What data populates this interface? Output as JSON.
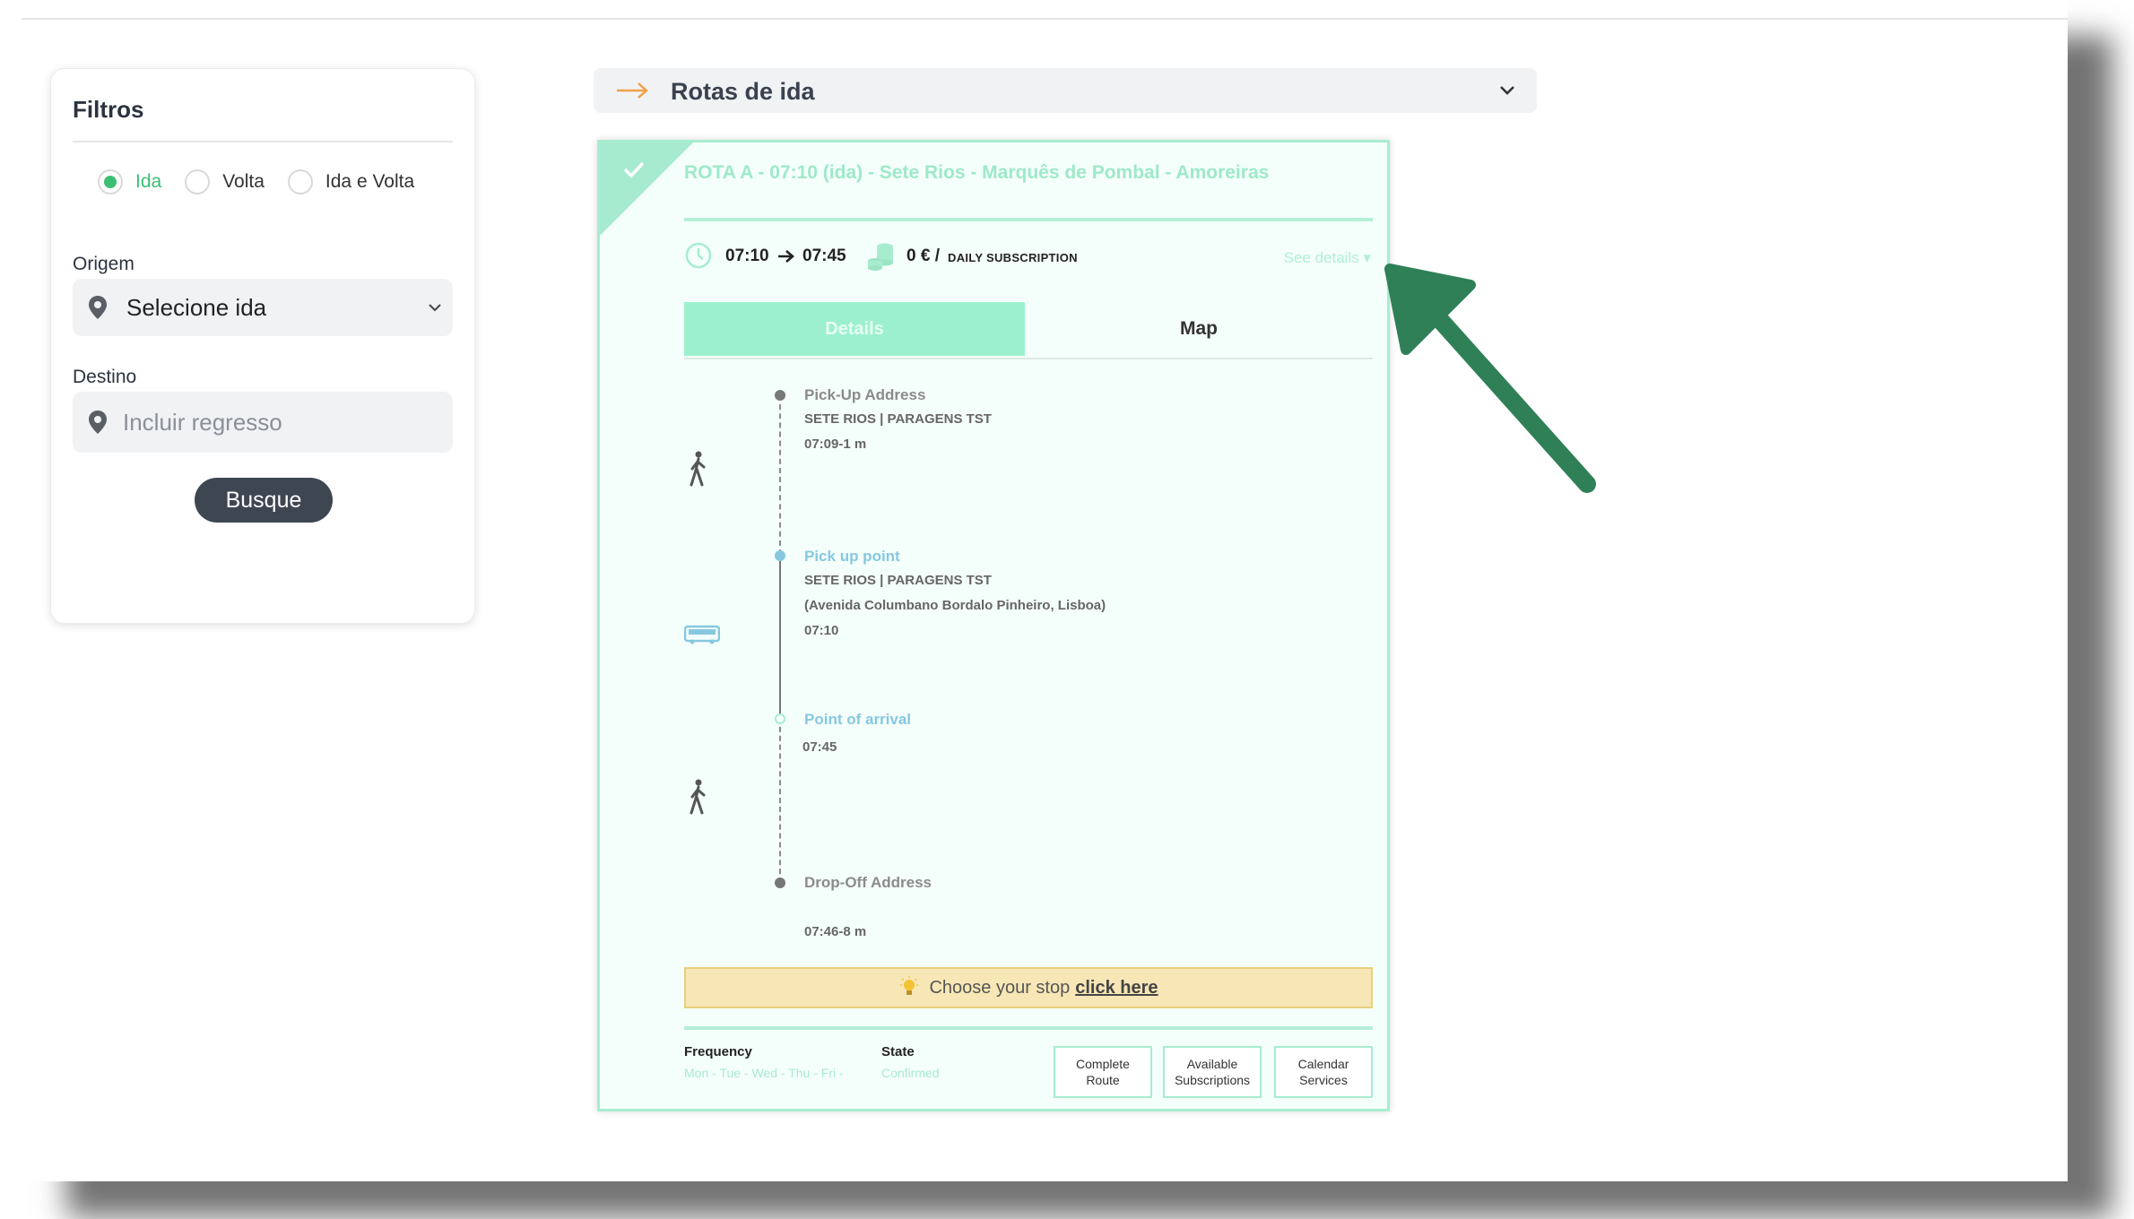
{
  "filters": {
    "title": "Filtros",
    "trip_options": [
      {
        "label": "Ida",
        "checked": true
      },
      {
        "label": "Volta",
        "checked": false
      },
      {
        "label": "Ida e Volta",
        "checked": false
      }
    ],
    "origin_label": "Origem",
    "origin_value": "Selecione ida",
    "destination_label": "Destino",
    "destination_placeholder": "Incluir regresso",
    "search_label": "Busque"
  },
  "routes_section": {
    "title": "Rotas de ida"
  },
  "route_card": {
    "title": "ROTA A - 07:10 (ida) - Sete Rios - Marquês de Pombal - Amoreiras",
    "departure": "07:10",
    "arrival": "07:45",
    "price": "0 € /",
    "price_sub": "DAILY SUBSCRIPTION",
    "see_details": "See details ▾",
    "tabs": {
      "details": "Details",
      "map": "Map"
    },
    "timeline": {
      "pickup_address": {
        "title": "Pick-Up Address",
        "line1": "SETE RIOS | PARAGENS TST",
        "line2": "07:09-1 m"
      },
      "pickup_point": {
        "title": "Pick up point",
        "line1": "SETE RIOS | PARAGENS TST",
        "line2": "(Avenida Columbano Bordalo Pinheiro, Lisboa)",
        "time": "07:10"
      },
      "arrival_point": {
        "title": "Point of arrival",
        "time": "07:45"
      },
      "dropoff_address": {
        "title": "Drop-Off Address",
        "time": "07:46-8 m"
      }
    },
    "choose_stop": {
      "text": "Choose your stop",
      "link": "click here"
    },
    "frequency_label": "Frequency",
    "frequency_value": "Mon - Tue - Wed - Thu - Fri -",
    "state_label": "State",
    "state_value": "Confirmed",
    "buttons": {
      "complete_route": "Complete Route",
      "available_subscriptions": "Available Subscriptions",
      "calendar_services": "Calendar Services"
    }
  },
  "colors": {
    "accent_green": "#3cbf73",
    "card_mint": "#a8ecd0",
    "annotation_arrow": "#2f8057",
    "orange_arrow": "#f0a14a"
  }
}
